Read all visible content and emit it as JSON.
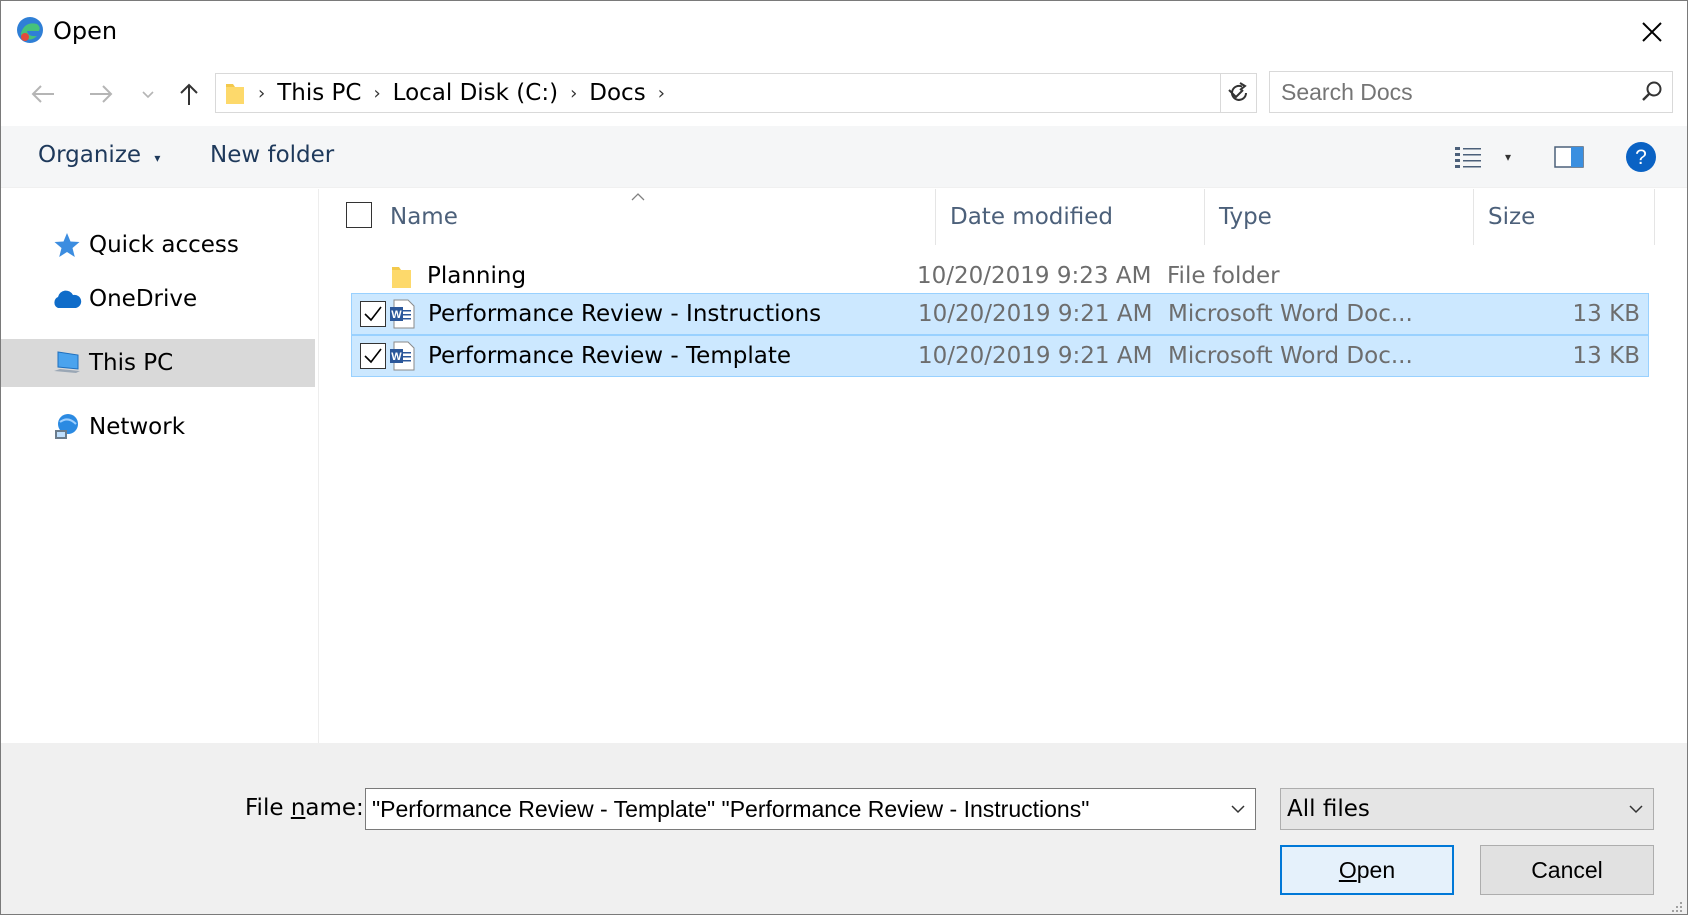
{
  "window": {
    "title": "Open"
  },
  "addressbar": {
    "crumbs": [
      "This PC",
      "Local Disk (C:)",
      "Docs"
    ]
  },
  "search": {
    "placeholder": "Search Docs"
  },
  "commandbar": {
    "organize_label": "Organize",
    "new_folder_label": "New folder"
  },
  "navpane": {
    "items": [
      {
        "label": "Quick access",
        "icon": "star-icon"
      },
      {
        "label": "OneDrive",
        "icon": "cloud-icon"
      },
      {
        "label": "This PC",
        "icon": "computer-icon"
      },
      {
        "label": "Network",
        "icon": "network-icon"
      }
    ],
    "selected": "This PC"
  },
  "filelist": {
    "columns": [
      "Name",
      "Date modified",
      "Type",
      "Size"
    ],
    "rows": [
      {
        "name": "Planning",
        "date": "10/20/2019 9:23 AM",
        "type": "File folder",
        "size": "",
        "icon": "folder-icon",
        "selected": false
      },
      {
        "name": "Performance Review - Instructions",
        "date": "10/20/2019 9:21 AM",
        "type": "Microsoft Word Doc...",
        "size": "13 KB",
        "icon": "word-doc-icon",
        "selected": true
      },
      {
        "name": "Performance Review - Template",
        "date": "10/20/2019 9:21 AM",
        "type": "Microsoft Word Doc...",
        "size": "13 KB",
        "icon": "word-doc-icon",
        "selected": true
      }
    ]
  },
  "bottom": {
    "filename_label_pre": "File ",
    "filename_label_accel": "n",
    "filename_label_post": "ame:",
    "filename_value": "\"Performance Review - Template\" \"Performance Review - Instructions\"",
    "filter_value": "All files",
    "open_label_accel": "O",
    "open_label_rest": "pen",
    "cancel_label": "Cancel"
  },
  "colors": {
    "selection_bg": "#cce8ff",
    "selection_border": "#99d1ff",
    "accent": "#0078d7",
    "nav_selected": "#d9d9d9",
    "command_text": "#1e395b"
  }
}
